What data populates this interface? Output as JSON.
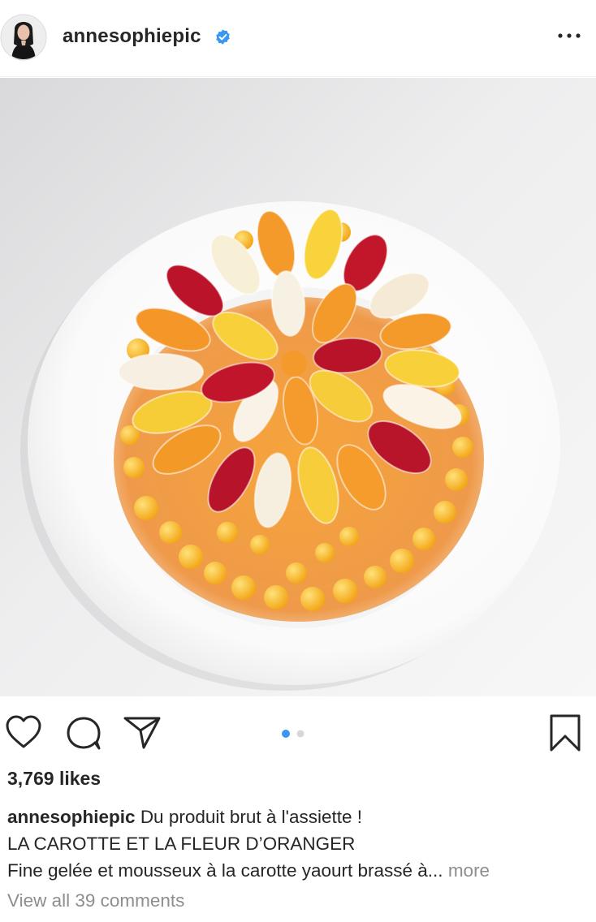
{
  "post": {
    "username": "annesophiepic",
    "verified": true,
    "likes": "3,769 likes",
    "caption_username": "annesophiepic",
    "caption_line1": "Du produit brut à l'assiette !",
    "caption_line2": "LA CAROTTE ET LA FLEUR D’ORANGER",
    "caption_line3": "Fine gelée et mousseux à la carotte yaourt brassé à...",
    "more_label": "more",
    "view_comments": "View all 39 comments",
    "carousel": {
      "total": 2,
      "active": 1
    }
  },
  "icons": {
    "avatar": "profile-photo",
    "verified": "verified-badge-icon",
    "options": "more-options-icon",
    "like": "heart-icon",
    "comment": "comment-bubble-icon",
    "share": "paper-plane-icon",
    "save": "bookmark-icon"
  },
  "colors": {
    "verified_blue": "#3897f0",
    "carousel_active": "#3897f0",
    "carousel_inactive": "#d8d8d8",
    "muted_text": "#8e8e8e",
    "text": "#262626"
  }
}
